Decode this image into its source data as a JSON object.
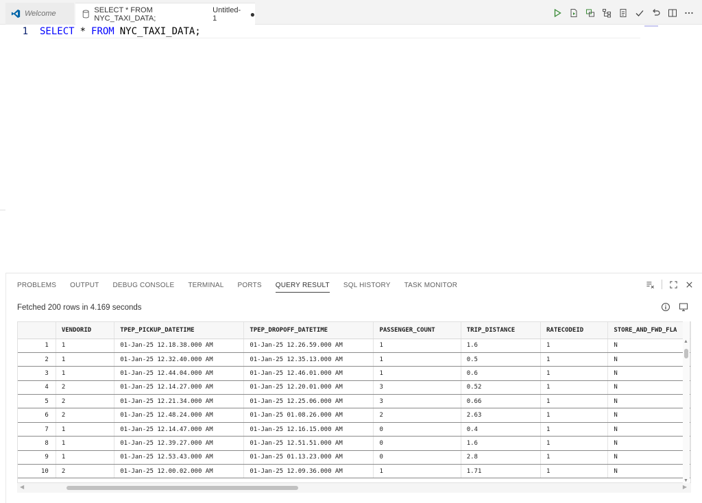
{
  "tabs": [
    {
      "label": "Welcome",
      "icon": "vscode-logo-icon"
    },
    {
      "label": "SELECT * FROM NYC_TAXI_DATA;",
      "suffix": "Untitled-1",
      "dirty": "●",
      "icon": "database-icon"
    }
  ],
  "editor": {
    "line_number": "1",
    "kw_select": "SELECT",
    "star": "*",
    "kw_from": "FROM",
    "table": "NYC_TAXI_DATA;"
  },
  "panel": {
    "tabs": [
      "PROBLEMS",
      "OUTPUT",
      "DEBUG CONSOLE",
      "TERMINAL",
      "PORTS",
      "QUERY RESULT",
      "SQL HISTORY",
      "TASK MONITOR"
    ],
    "active_tab": "QUERY RESULT",
    "status": "Fetched 200 rows in 4.169 seconds"
  },
  "grid": {
    "columns": [
      "",
      "VENDORID",
      "TPEP_PICKUP_DATETIME",
      "TPEP_DROPOFF_DATETIME",
      "PASSENGER_COUNT",
      "TRIP_DISTANCE",
      "RATECODEID",
      "STORE_AND_FWD_FLA"
    ],
    "rows": [
      [
        "1",
        "1",
        "01-Jan-25 12.18.38.000 AM",
        "01-Jan-25 12.26.59.000 AM",
        "1",
        "1.6",
        "1",
        "N"
      ],
      [
        "2",
        "1",
        "01-Jan-25 12.32.40.000 AM",
        "01-Jan-25 12.35.13.000 AM",
        "1",
        "0.5",
        "1",
        "N"
      ],
      [
        "3",
        "1",
        "01-Jan-25 12.44.04.000 AM",
        "01-Jan-25 12.46.01.000 AM",
        "1",
        "0.6",
        "1",
        "N"
      ],
      [
        "4",
        "2",
        "01-Jan-25 12.14.27.000 AM",
        "01-Jan-25 12.20.01.000 AM",
        "3",
        "0.52",
        "1",
        "N"
      ],
      [
        "5",
        "2",
        "01-Jan-25 12.21.34.000 AM",
        "01-Jan-25 12.25.06.000 AM",
        "3",
        "0.66",
        "1",
        "N"
      ],
      [
        "6",
        "2",
        "01-Jan-25 12.48.24.000 AM",
        "01-Jan-25 01.08.26.000 AM",
        "2",
        "2.63",
        "1",
        "N"
      ],
      [
        "7",
        "1",
        "01-Jan-25 12.14.47.000 AM",
        "01-Jan-25 12.16.15.000 AM",
        "0",
        "0.4",
        "1",
        "N"
      ],
      [
        "8",
        "1",
        "01-Jan-25 12.39.27.000 AM",
        "01-Jan-25 12.51.51.000 AM",
        "0",
        "1.6",
        "1",
        "N"
      ],
      [
        "9",
        "1",
        "01-Jan-25 12.53.43.000 AM",
        "01-Jan-25 01.13.23.000 AM",
        "0",
        "2.8",
        "1",
        "N"
      ],
      [
        "10",
        "2",
        "01-Jan-25 12.00.02.000 AM",
        "01-Jan-25 12.09.36.000 AM",
        "1",
        "1.71",
        "1",
        "N"
      ]
    ]
  },
  "colors": {
    "keyword": "#0000ff",
    "line_number": "#0b216f",
    "run_icon": "#388a34",
    "vscode_blue": "#0065a9"
  }
}
